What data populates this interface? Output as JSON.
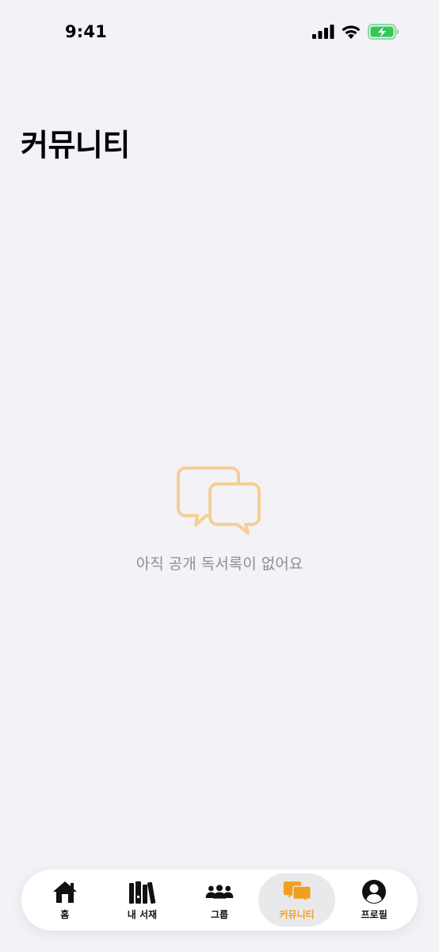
{
  "status_bar": {
    "time": "9:41"
  },
  "header": {
    "title": "커뮤니티"
  },
  "empty_state": {
    "icon": "chat-bubbles-icon",
    "message": "아직 공개 독서록이 없어요"
  },
  "tab_bar": {
    "active_color": "#f0a020",
    "items": [
      {
        "label": "홈",
        "icon": "home-icon"
      },
      {
        "label": "내 서재",
        "icon": "books-icon"
      },
      {
        "label": "그룹",
        "icon": "group-icon"
      },
      {
        "label": "커뮤니티",
        "icon": "chat-bubbles-icon",
        "active": true
      },
      {
        "label": "프로필",
        "icon": "profile-icon"
      }
    ]
  }
}
